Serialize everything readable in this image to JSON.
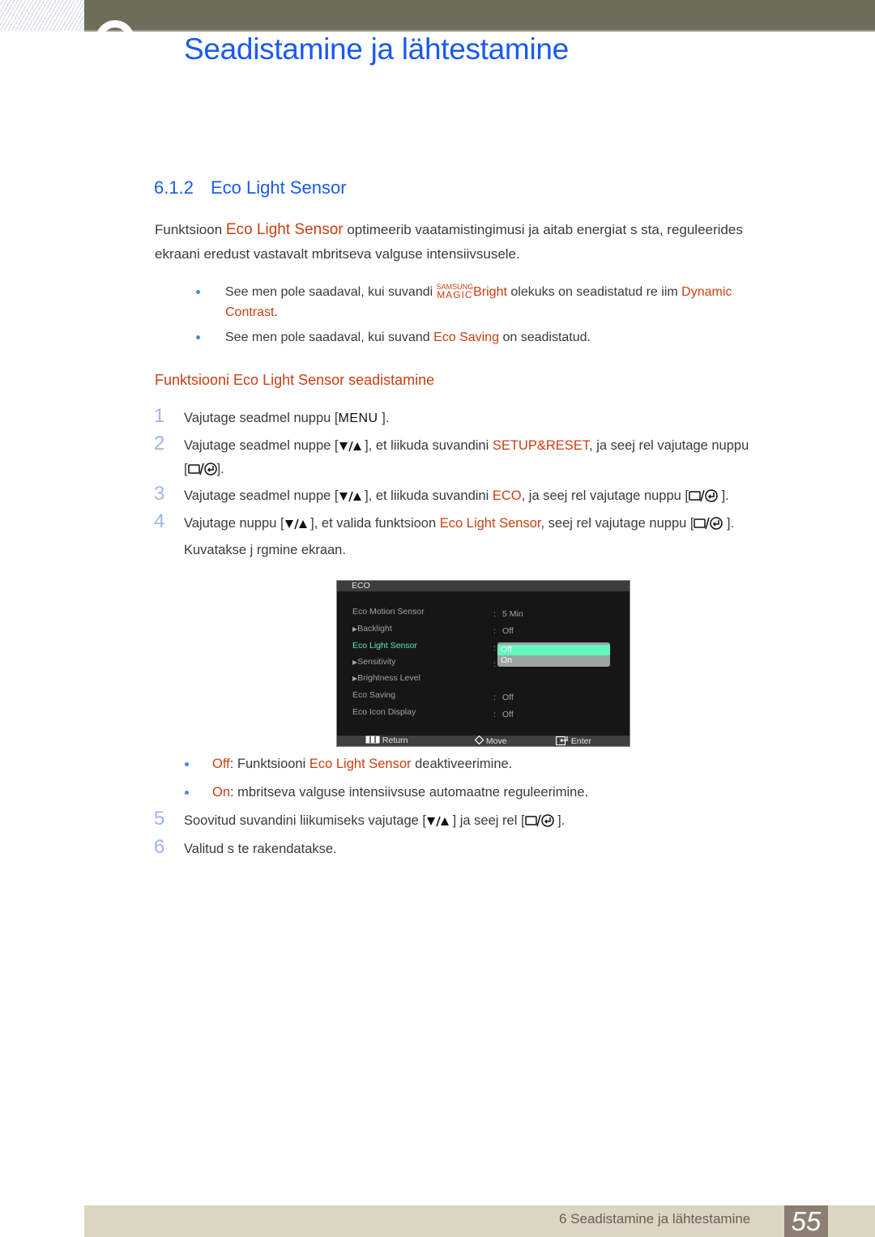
{
  "header": {
    "chapter_title": "Seadistamine ja lähtestamine"
  },
  "section": {
    "number": "6.1.2",
    "title": "Eco Light Sensor"
  },
  "intro": {
    "prefix": "Funktsioon ",
    "highlight": "Eco Light Sensor",
    "line1_rest": " optimeerib vaatamistingimusi ja aitab energiat s  sta, reguleerides",
    "line2": "ekraani eredust vastavalt  mbritseva valguse intensiivsusele."
  },
  "notes": [
    {
      "text1": "See men   pole saadaval, kui suvandi ",
      "magic_top": "SAMSUNG",
      "magic_bottom": "MAGIC",
      "hl1": "Bright",
      "text2": " olekuks on seadistatud re iim ",
      "hl2": "Dynamic",
      "hl3": "Contrast",
      "end": "."
    },
    {
      "text1": "See men   pole saadaval, kui suvand ",
      "hl1": "Eco Saving",
      "text2": " on seadistatud."
    }
  ],
  "procedure": {
    "heading": "Funktsiooni Eco Light Sensor seadistamine",
    "steps": [
      {
        "num": "1",
        "text1": "Vajutage seadmel nuppu [",
        "key": "MENU",
        "text2": " ]."
      },
      {
        "num": "2",
        "text1": "Vajutage seadmel nuppe [",
        "text2": " ], et liikuda suvandini ",
        "hl": "SETUP&RESET",
        "text3": ", ja seej rel vajutage nuppu",
        "cont": "[",
        "cont_end": "]."
      },
      {
        "num": "3",
        "text1": "Vajutage seadmel nuppe [",
        "text2": " ], et liikuda suvandini ",
        "hl": "ECO",
        "text3": ", ja seej rel vajutage nuppu [",
        "text4": " ]."
      },
      {
        "num": "4",
        "text1": "Vajutage nuppu [",
        "text2": " ], et valida funktsioon ",
        "hl": "Eco Light Sensor",
        "text3": ", seej rel vajutage nuppu [",
        "text4": " ].",
        "cont": "Kuvatakse j rgmine ekraan."
      },
      {
        "num": "5",
        "text1": "Soovitud suvandini liikumiseks vajutage [",
        "text2": " ] ja seej rel [",
        "text3": " ]."
      },
      {
        "num": "6",
        "text1": "Valitud s te rakendatakse."
      }
    ],
    "options": [
      {
        "label": "Off",
        "sep": ": Funktsiooni ",
        "hl": "Eco Light Sensor",
        "rest": " deaktiveerimine."
      },
      {
        "label": "On",
        "sep": ":  mbritseva valguse intensiivsuse automaatne reguleerimine."
      }
    ]
  },
  "osd": {
    "title": "ECO",
    "rows": [
      {
        "label": "Eco Motion Sensor",
        "value": "5 Min",
        "arrow": false,
        "selected": false
      },
      {
        "label": "Backlight",
        "value": "Off",
        "arrow": true,
        "selected": false
      },
      {
        "label": "Eco Light Sensor",
        "value": "",
        "arrow": false,
        "selected": true
      },
      {
        "label": "Sensitivity",
        "value": "",
        "arrow": true,
        "selected": false
      },
      {
        "label": "Brightness Level",
        "value": "",
        "arrow": true,
        "selected": false
      },
      {
        "label": "Eco Saving",
        "value": "Off",
        "arrow": false,
        "selected": false
      },
      {
        "label": "Eco Icon Display",
        "value": "Off",
        "arrow": false,
        "selected": false
      }
    ],
    "dropdown": {
      "options": [
        "Off",
        "On"
      ],
      "selected": "Off"
    },
    "footer": {
      "return": "Return",
      "move": "Move",
      "enter": "Enter"
    },
    "colors": {
      "selected_text": "#5fe7b8",
      "selected_option_bg": "#63f7bd"
    }
  },
  "footer": {
    "chapter_label": "6 Seadistamine ja lähtestamine",
    "page_number": "55"
  },
  "colors": {
    "title_blue": "#1a5af0",
    "highlight_orange": "#c8400f",
    "step_number": "#9db5e8",
    "topbar": "#6e6d59",
    "footer_band": "#dcd5c1",
    "page_box": "#8b7e73"
  }
}
